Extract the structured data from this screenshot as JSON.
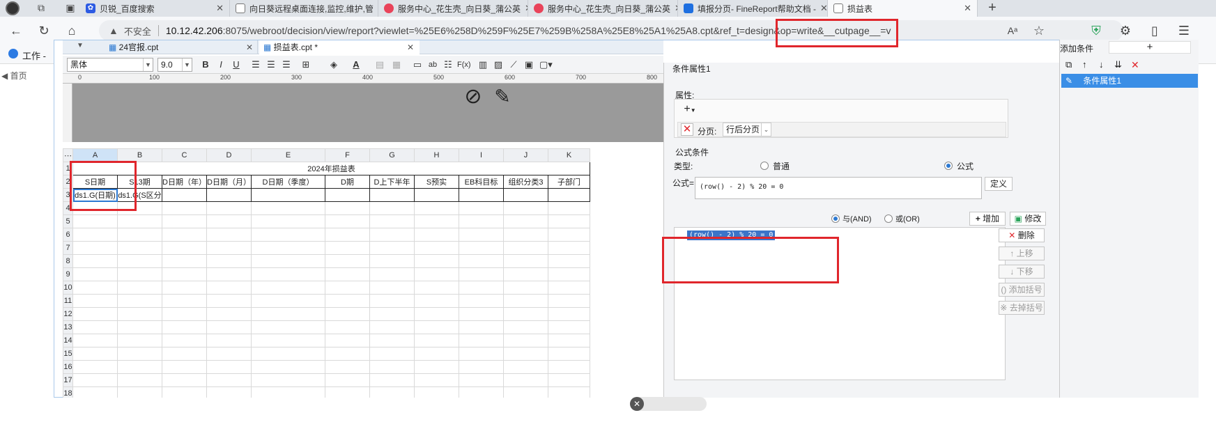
{
  "browser": {
    "tabs": [
      {
        "label": "贝锐_百度搜索",
        "icon": "baidu-paw-icon",
        "color": "#2d5be3"
      },
      {
        "label": "向日葵远程桌面连接,监控,维护,管",
        "icon": "document-icon",
        "color": "#666666"
      },
      {
        "label": "服务中心_花生壳_向日葵_蒲公英",
        "icon": "oray-icon",
        "color": "#e9435a"
      },
      {
        "label": "服务中心_花生壳_向日葵_蒲公英",
        "icon": "oray-icon",
        "color": "#e9435a"
      },
      {
        "label": "填报分页- FineReport帮助文档 -",
        "icon": "finereport-icon",
        "color": "#1e6fe0"
      },
      {
        "label": "损益表",
        "icon": "document-icon",
        "color": "#666666"
      }
    ],
    "new_tab": "+",
    "insecure_label": "不安全",
    "url_host": "10.12.42.206",
    "url_rest": ":8075/webroot/decision/view/report?viewlet=%25E6%258D%259F%25E7%259B%258A%25E8%25A1%25A8.cpt&ref_t=design&op=write&__cutpage__=v",
    "bookmark_label": "工作 -",
    "left_nav": "◀ 首页"
  },
  "designer": {
    "doc_tabs": [
      "24官报.cpt",
      "损益表.cpt *"
    ],
    "font_family": "黑体",
    "font_size": "9.0",
    "ruler_marks": [
      "0",
      "100",
      "200",
      "300",
      "400",
      "500",
      "600",
      "700",
      "800"
    ],
    "columns": [
      "A",
      "B",
      "C",
      "D",
      "E",
      "F",
      "G",
      "H",
      "I",
      "J",
      "K"
    ],
    "row_numbers": [
      "1",
      "2",
      "3",
      "4",
      "5",
      "6",
      "7",
      "8",
      "9",
      "10",
      "11",
      "12",
      "13",
      "14",
      "15",
      "16",
      "17",
      "18"
    ],
    "title_cell": "2024年损益表",
    "header_row": [
      "S日期",
      "S13期",
      "D日期（年）",
      "D日期（月）",
      "D日期（季度）",
      "D期",
      "D上下半年",
      "S预实",
      "EB科目标",
      "组织分类3",
      "子部门"
    ],
    "data_row": [
      "ds1.G(日期)",
      "ds1.G(S区分",
      "",
      "",
      "",
      "",
      "",
      "",
      "",
      "",
      ""
    ]
  },
  "condition_panel": {
    "title": "条件属性1",
    "attr_label": "属性:",
    "add_symbol": "+",
    "pagination_label": "分页:",
    "pagination_value": "行后分页",
    "formula_group_label": "公式条件",
    "type_label": "类型:",
    "type_normal": "普通",
    "type_formula": "公式",
    "formula_label": "公式=",
    "formula_value": "(row() - 2) % 20 = 0",
    "define_button": "定义",
    "and_label": "与(AND)",
    "or_label": "或(OR)",
    "add_button": "增加",
    "modify_button": "修改",
    "condition_item": "(row() - 2) % 20 = 0",
    "delete_button": "删除",
    "up_button": "上移",
    "down_button": "下移",
    "add_paren_button": "添加括号",
    "remove_paren_button": "去掉括号"
  },
  "side_panel": {
    "title": "添加条件",
    "add_symbol": "+",
    "item": "条件属性1"
  }
}
